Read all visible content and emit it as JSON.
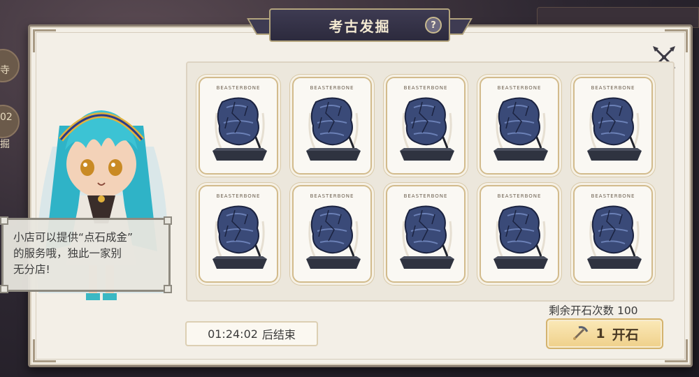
{
  "title": "考古发掘",
  "help_label": "?",
  "card_header": "BEASTERBONE",
  "npc_dialog": {
    "line1": "小店可以提供“点石成金”",
    "line2": "的服务哦，独此一家别",
    "line3": "无分店!"
  },
  "timer": {
    "time": "01:24:02",
    "suffix": "后结束"
  },
  "remaining": {
    "label": "剩余开石次数",
    "count": "100"
  },
  "open_button": {
    "cost": "1",
    "label": "开石"
  },
  "background": {
    "left_text_1": "寺",
    "left_text_2": "02",
    "left_text_3": "掘"
  },
  "colors": {
    "panel_bg": "#f3efe7",
    "title_banner": "#2c2a3d",
    "card_border": "#d2bb8c",
    "button_gold": "#efd08a",
    "npc_hair": "#3cc3d4"
  },
  "cards": [
    {
      "name": "ore-card-1"
    },
    {
      "name": "ore-card-2"
    },
    {
      "name": "ore-card-3"
    },
    {
      "name": "ore-card-4"
    },
    {
      "name": "ore-card-5"
    },
    {
      "name": "ore-card-6"
    },
    {
      "name": "ore-card-7"
    },
    {
      "name": "ore-card-8"
    },
    {
      "name": "ore-card-9"
    },
    {
      "name": "ore-card-10"
    }
  ]
}
